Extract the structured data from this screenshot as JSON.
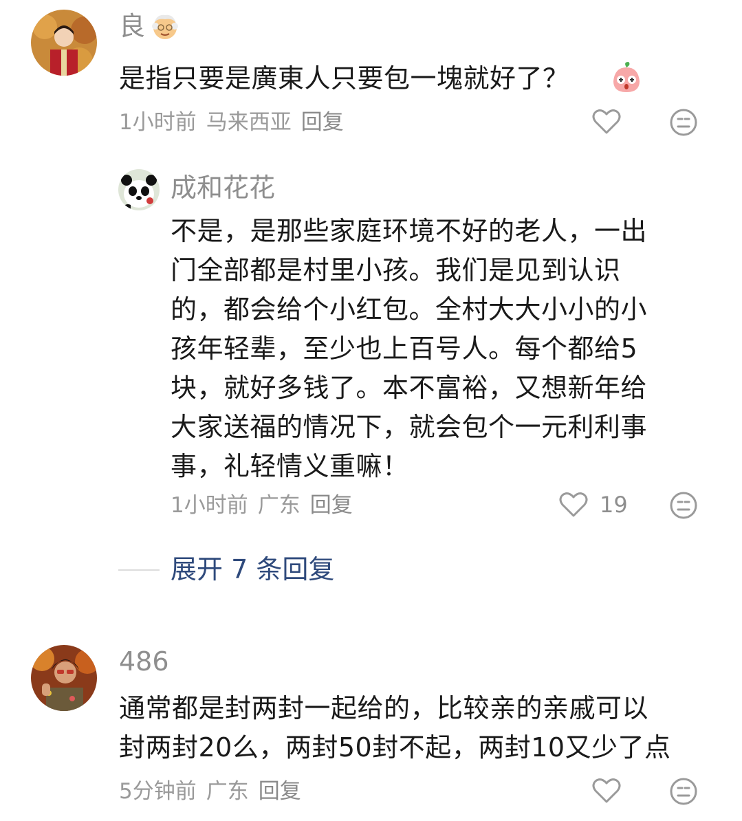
{
  "comments": [
    {
      "author": "良",
      "badge_icon": "grandfather-emoji-icon",
      "text": "是指只要是廣東人只要包一塊就好了？",
      "emoji_icon": "cute-peach-sticker-icon",
      "time": "1小时前",
      "location": "马来西亚",
      "reply_label": "回复"
    },
    {
      "author": "486",
      "text_line1": "通常都是封两封一起给的，比较亲的亲戚可以",
      "text_line2": "封两封20么，两封50封不起，两封10又少了点",
      "time": "5分钟前",
      "location": "广东",
      "reply_label": "回复"
    }
  ],
  "reply": {
    "author": "成和花花",
    "lines": [
      "不是，是那些家庭环境不好的老人，一出",
      "门全部都是村里小孩。我们是见到认识",
      "的，都会给个小红包。全村大大小小的小",
      "孩年轻辈，至少也上百号人。每个都给5",
      "块，就好多钱了。本不富裕，又想新年给",
      "大家送福的情况下，就会包个一元利利事",
      "事，礼轻情义重嘛！"
    ],
    "time": "1小时前",
    "location": "广东",
    "reply_label": "回复",
    "like_count": "19"
  },
  "expand_replies": {
    "label": "展开 7 条回复"
  },
  "colors": {
    "text": "#1a1a1a",
    "meta": "#9a9a9a",
    "expand_link": "#2f4a7c"
  }
}
